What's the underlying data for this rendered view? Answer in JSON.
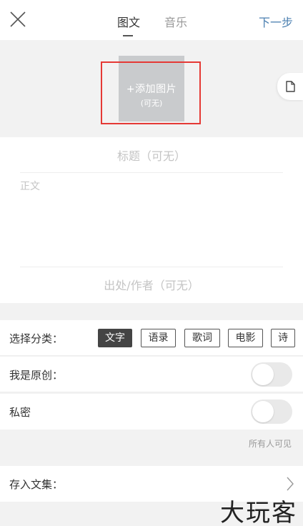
{
  "header": {
    "tabs": [
      {
        "label": "图文",
        "active": true
      },
      {
        "label": "音乐",
        "active": false
      }
    ],
    "next_label": "下一步",
    "close_icon": "close-icon"
  },
  "media": {
    "add_image_label": "+添加图片",
    "add_image_hint": "(可无)",
    "side_icon": "document-icon"
  },
  "editor": {
    "title_placeholder": "标题（可无）",
    "body_placeholder": "正文",
    "source_placeholder": "出处/作者（可无）"
  },
  "category": {
    "label": "选择分类：",
    "options": [
      "文字",
      "语录",
      "歌词",
      "电影",
      "诗"
    ],
    "selected": "文字"
  },
  "original": {
    "label": "我是原创：",
    "enabled": false
  },
  "private": {
    "label": "私密",
    "enabled": false
  },
  "visibility_note": "所有人可见",
  "collection": {
    "label": "存入文集："
  },
  "watermark": "大玩客",
  "colors": {
    "accent": "#4a7fb0",
    "highlight": "#e53935",
    "selected_chip": "#444444"
  }
}
